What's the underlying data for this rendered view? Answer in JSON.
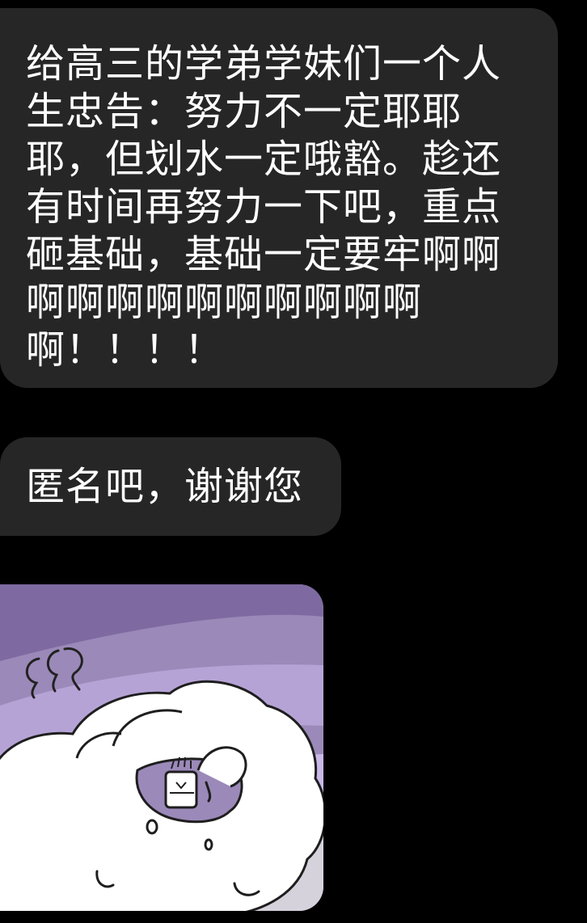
{
  "messages": [
    {
      "type": "text",
      "text": "给高三的学弟学妹们一个人生忠告：努力不一定耶耶耶，但划水一定哦豁。趁还有时间再努力一下吧，重点砸基础，基础一定要牢啊啊啊啊啊啊啊啊啊啊啊啊啊！！！！"
    },
    {
      "type": "text",
      "text": "匿名吧，谢谢您"
    },
    {
      "type": "sticker",
      "icon": "crying-cartoon-sticker",
      "colors": {
        "background": "#9b89b9",
        "dark_band": "#7e6aa0",
        "light_band": "#c9b8e8",
        "floor": "#d6d2dc",
        "character": "#ffffff"
      }
    }
  ],
  "theme": {
    "page_background": "#000000",
    "bubble_background": "#262626",
    "text_color": "#ffffff"
  }
}
